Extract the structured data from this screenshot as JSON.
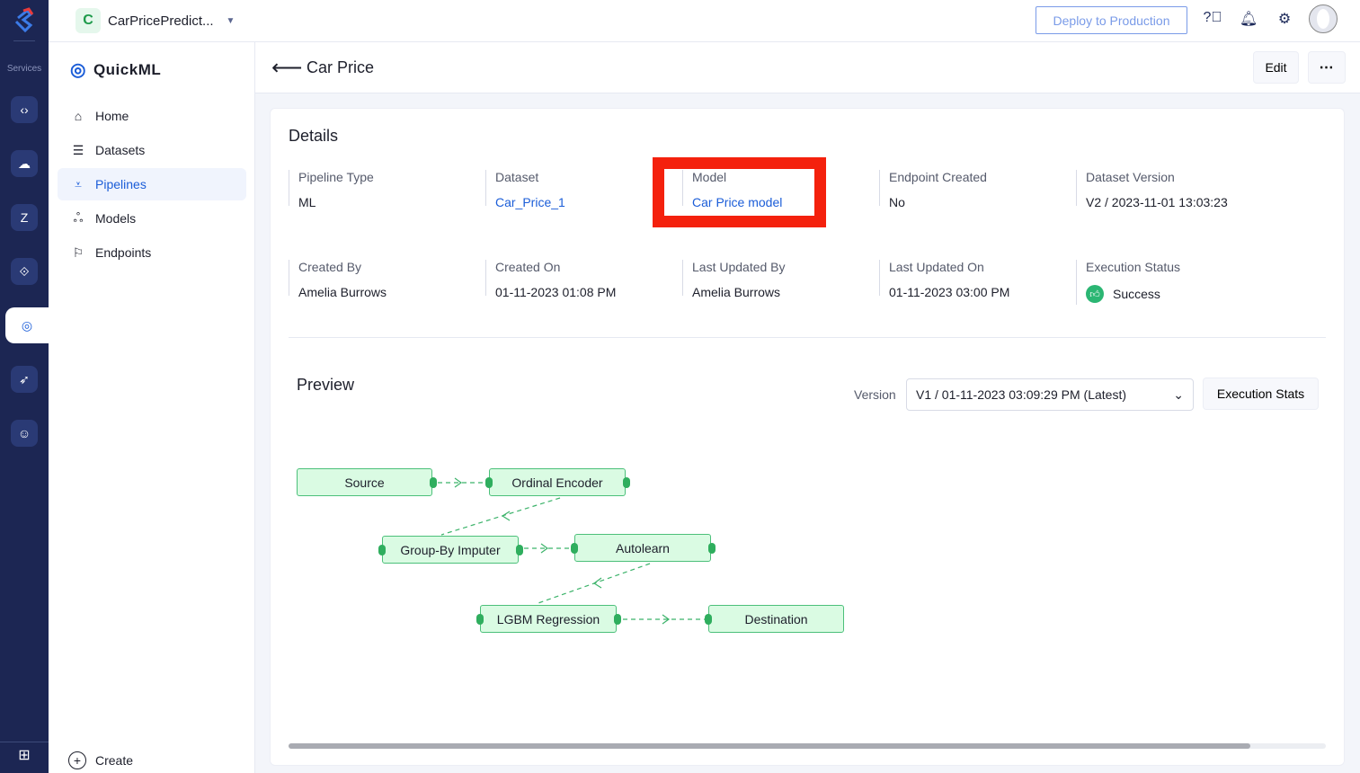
{
  "rail": {
    "services_label": "Services"
  },
  "topbar": {
    "project_initial": "C",
    "project_name": "CarPricePredict...",
    "deploy_label": "Deploy to Production"
  },
  "sidebar": {
    "brand": "QuickML",
    "items": [
      {
        "label": "Home",
        "icon": "home-icon"
      },
      {
        "label": "Datasets",
        "icon": "database-icon"
      },
      {
        "label": "Pipelines",
        "icon": "pipeline-icon",
        "active": true
      },
      {
        "label": "Models",
        "icon": "models-icon"
      },
      {
        "label": "Endpoints",
        "icon": "flag-icon"
      }
    ],
    "create_label": "Create"
  },
  "header": {
    "title": "Car Price",
    "edit_label": "Edit",
    "more_label": "⋯"
  },
  "details": {
    "title": "Details",
    "fields": [
      {
        "label": "Pipeline Type",
        "value": "ML"
      },
      {
        "label": "Dataset",
        "value": "Car_Price_1",
        "link": true
      },
      {
        "label": "Model",
        "value": "Car Price model",
        "link": true,
        "highlighted": true
      },
      {
        "label": "Endpoint Created",
        "value": "No"
      },
      {
        "label": "Dataset Version",
        "value": "V2 / 2023-11-01 13:03:23"
      },
      {
        "label": "Created By",
        "value": "Amelia Burrows"
      },
      {
        "label": "Created On",
        "value": "01-11-2023 01:08 PM"
      },
      {
        "label": "Last Updated By",
        "value": "Amelia Burrows"
      },
      {
        "label": "Last Updated On",
        "value": "01-11-2023 03:00 PM"
      },
      {
        "label": "Execution Status",
        "value": "Success",
        "status_color": "#2bb673"
      }
    ]
  },
  "preview": {
    "title": "Preview",
    "version_label": "Version",
    "version_value": "V1 / 01-11-2023 03:09:29 PM (Latest)",
    "stats_label": "Execution Stats",
    "nodes": [
      "Source",
      "Ordinal Encoder",
      "Group-By Imputer",
      "Autolearn",
      "LGBM Regression",
      "Destination"
    ]
  },
  "colors": {
    "accent": "#1b5dd8",
    "rail": "#1c2653",
    "node_fill": "#dafbe3",
    "node_border": "#4cc07a",
    "highlight": "#f4210d"
  }
}
